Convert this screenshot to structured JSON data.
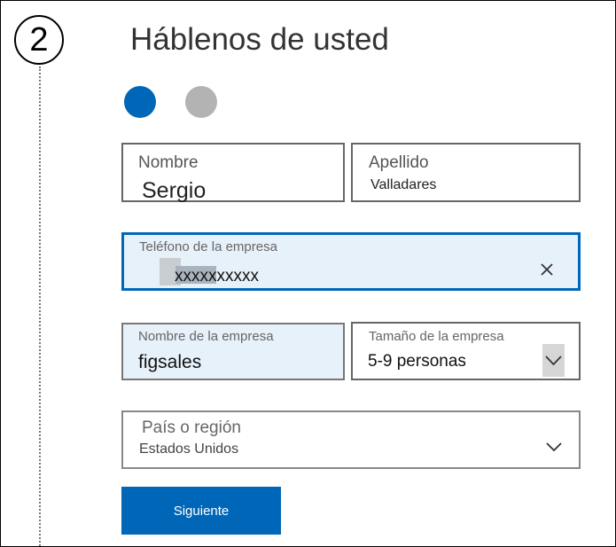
{
  "step": {
    "number": "2"
  },
  "header": {
    "title": "Háblenos de usted"
  },
  "progress": {
    "current_step": 1,
    "total_steps": 2
  },
  "form": {
    "first_name": {
      "label": "Nombre",
      "value": "Sergio"
    },
    "last_name": {
      "label": "Apellido",
      "value": "Valladares"
    },
    "company_phone": {
      "label": "Teléfono de la empresa",
      "value": "xxxxxxxxxx"
    },
    "company_name": {
      "label": "Nombre de la empresa",
      "value": "figsales"
    },
    "company_size": {
      "label": "Tamaño de la empresa",
      "value": "5-9 personas"
    },
    "country": {
      "label": "País o región",
      "value": "Estados Unidos"
    }
  },
  "actions": {
    "next_label": "Siguiente"
  },
  "colors": {
    "accent": "#0067b8",
    "inactive_dot": "#b3b3b3",
    "focus_fill": "#e7f1fa"
  },
  "icons": {
    "clear": "close-icon",
    "dropdown": "chevron-down-icon"
  }
}
